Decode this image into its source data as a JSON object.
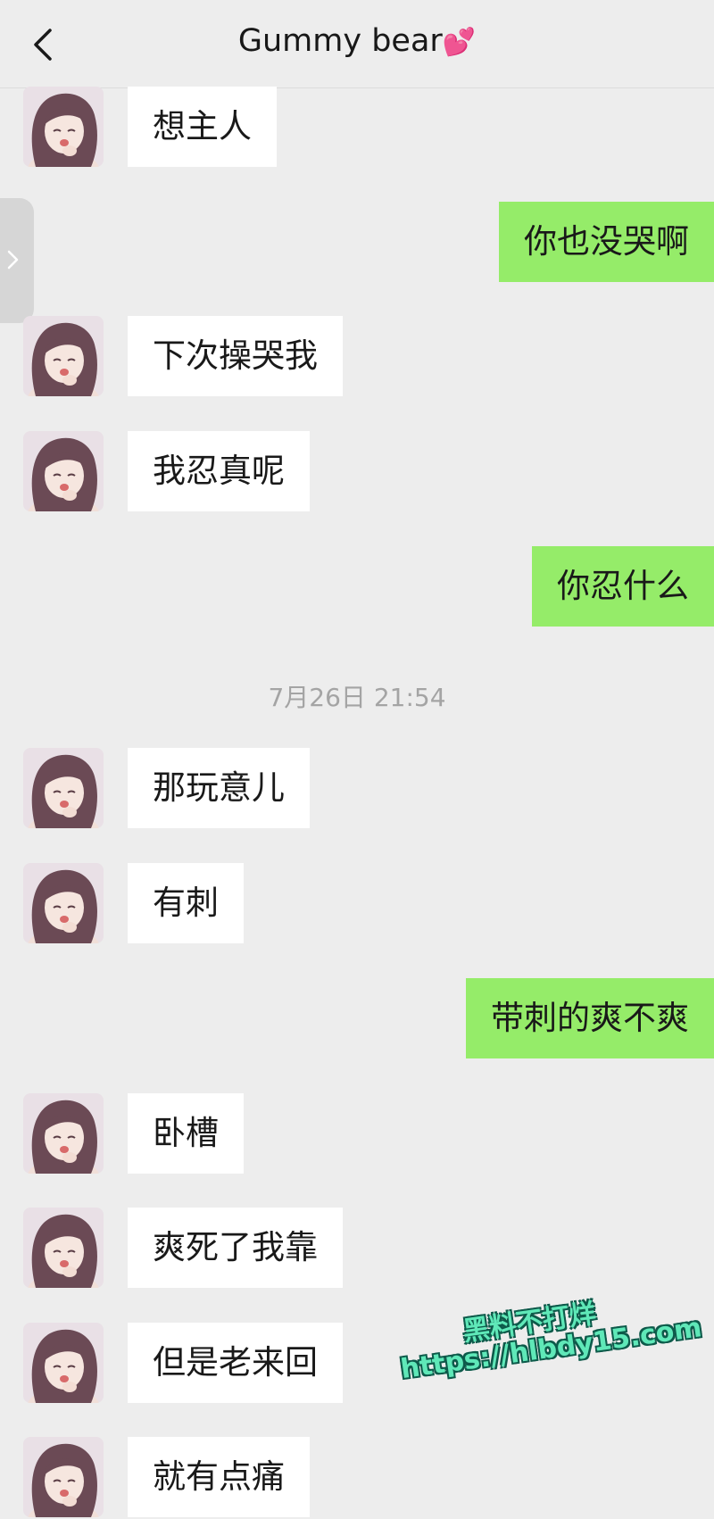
{
  "header": {
    "title": "Gummy bear",
    "title_emoji": "💕",
    "back_icon": "chevron-left-icon"
  },
  "colors": {
    "background": "#ededed",
    "incoming_bubble": "#ffffff",
    "outgoing_bubble": "#95ec69",
    "timestamp": "#a4a4a4"
  },
  "messages": [
    {
      "side": "left",
      "text": "想主人"
    },
    {
      "side": "right",
      "text": "你也没哭啊"
    },
    {
      "side": "left",
      "text": "下次操哭我"
    },
    {
      "side": "left",
      "text": "我忍真呢"
    },
    {
      "side": "right",
      "text": "你忍什么"
    },
    {
      "side": "left",
      "text": "那玩意儿"
    },
    {
      "side": "left",
      "text": "有刺"
    },
    {
      "side": "right",
      "text": "带刺的爽不爽"
    },
    {
      "side": "left",
      "text": "卧槽"
    },
    {
      "side": "left",
      "text": "爽死了我靠"
    },
    {
      "side": "left",
      "text": "但是老来回"
    },
    {
      "side": "left",
      "text": "就有点痛"
    }
  ],
  "timestamp": "7月26日 21:54",
  "watermark": {
    "line1": "黑料不打烊",
    "line2": "https://hlbdy15.com"
  }
}
